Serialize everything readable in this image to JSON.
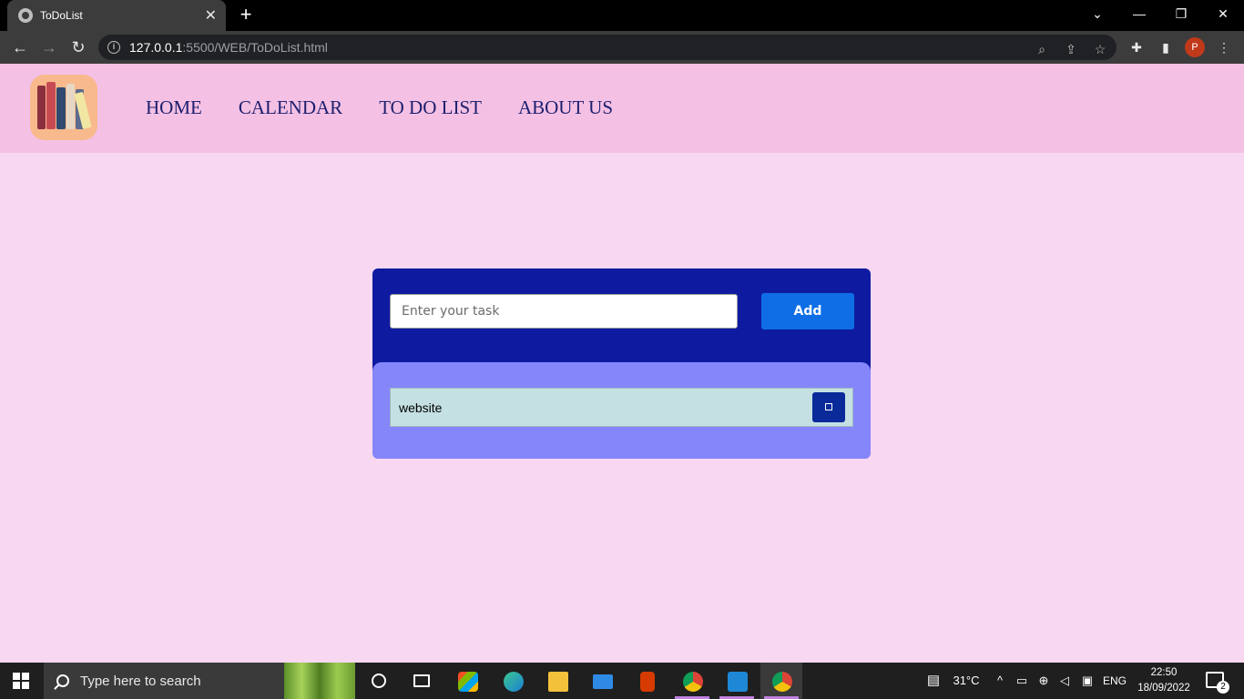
{
  "browser": {
    "tab_title": "ToDoList",
    "tab_close": "✕",
    "new_tab": "+",
    "url_host": "127.0.0.1",
    "url_path": ":5500/WEB/ToDoList.html",
    "profile_initial": "P",
    "window_controls": {
      "dropdown": "⌄",
      "minimize": "—",
      "restore": "❐",
      "close": "✕"
    }
  },
  "page": {
    "nav": {
      "home": "HOME",
      "calendar": "CALENDAR",
      "todo": "TO DO LIST",
      "about": "ABOUT US"
    },
    "task_input_placeholder": "Enter your task",
    "add_label": "Add",
    "tasks": [
      {
        "text": "website"
      }
    ],
    "colors": {
      "page_bg": "#f8d7f0",
      "header_bg": "#f4c0e4",
      "card_top": "#0e1ba0",
      "card_bottom": "#8686fb",
      "add_button": "#0f6ee6",
      "task_row": "#c4e0e3",
      "delete_button": "#0a2a9a"
    }
  },
  "taskbar": {
    "search_placeholder": "Type here to search",
    "weather": "31°C",
    "language": "ENG",
    "time": "22:50",
    "date": "18/09/2022",
    "notification_count": "2"
  }
}
